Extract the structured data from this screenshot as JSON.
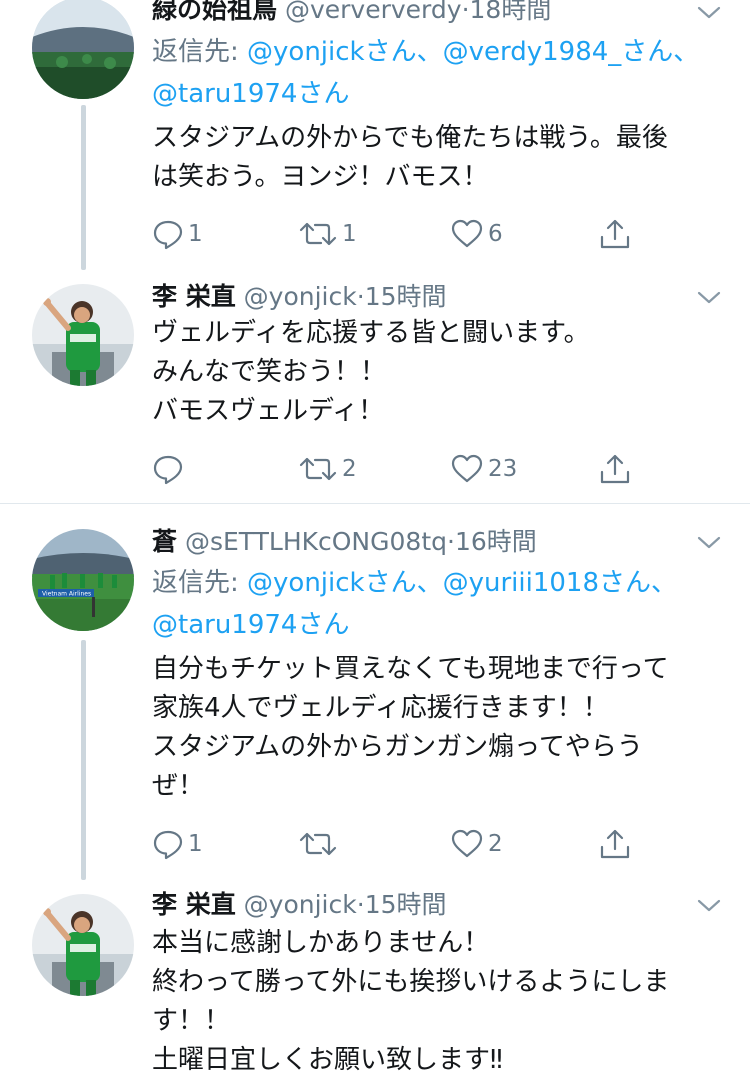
{
  "colors": {
    "link": "#1da1f2",
    "secondary": "#657786",
    "text": "#14171a",
    "thread_line": "#ccd6dd",
    "divider": "#e1e8ed"
  },
  "tweets": [
    {
      "display_name": "緑の始祖鳥",
      "handle": "@verververdy",
      "dot": "·",
      "time": "18時間",
      "reply_label": "返信先: ",
      "mentions": [
        "@yonjickさん、",
        "@verdy1984_さん、",
        "@taru1974さん"
      ],
      "text_lines": [
        "スタジアムの外からでも俺たちは戦う。最後",
        "は笑おう。ヨンジ！バモス！"
      ],
      "replies": "1",
      "retweets": "1",
      "likes": "6",
      "avatar": "stadium-green"
    },
    {
      "display_name": "李 栄直",
      "handle": "@yonjick",
      "dot": "·",
      "time": "15時間",
      "text_lines": [
        "ヴェルディを応援する皆と闘います。",
        "みんなで笑おう！！",
        "バモスヴェルディ！"
      ],
      "replies": "",
      "retweets": "2",
      "likes": "23",
      "avatar": "player-green-kit"
    },
    {
      "display_name": "蒼",
      "handle": "@sETTLHKcONG08tq",
      "dot": "·",
      "time": "16時間",
      "reply_label": "返信先: ",
      "mentions": [
        "@yonjickさん、",
        "@yuriii1018さん、",
        "@taru1974さん"
      ],
      "text_lines": [
        "自分もチケット買えなくても現地まで行って",
        "家族4人でヴェルディ応援行きます！！",
        "スタジアムの外からガンガン煽ってやらう",
        "ぜ！"
      ],
      "replies": "1",
      "retweets": "",
      "likes": "2",
      "avatar": "pitch-team",
      "avatar_banner": "Vietnam Airlines"
    },
    {
      "display_name": "李 栄直",
      "handle": "@yonjick",
      "dot": "·",
      "time": "15時間",
      "text_lines": [
        "本当に感謝しかありません！",
        "終わって勝って外にも挨拶いけるようにしま",
        "す！！",
        "土曜日宜しくお願い致します‼︎"
      ],
      "avatar": "player-green-kit"
    }
  ]
}
